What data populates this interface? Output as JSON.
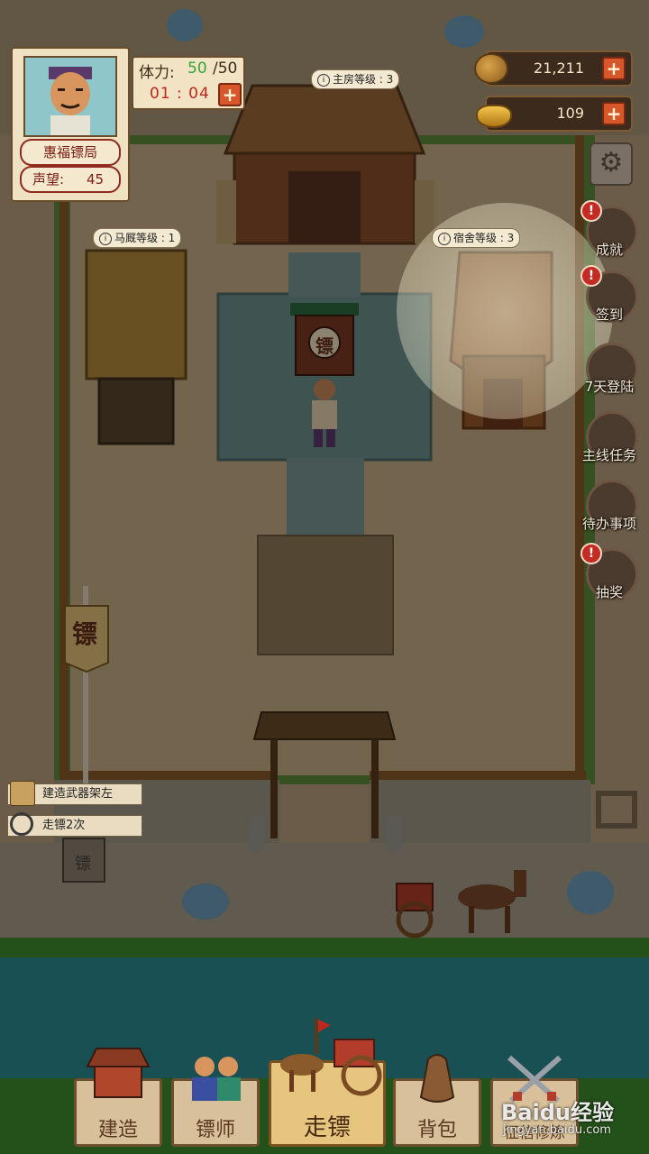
{
  "player": {
    "title": "惠福镖局",
    "reputation_label": "声望:",
    "reputation_value": "45"
  },
  "stamina": {
    "label": "体力:",
    "current": "50",
    "max": "/50",
    "timer": "01 : 04"
  },
  "resources": {
    "coins": "21,211",
    "ingots": "109"
  },
  "buildings": {
    "main_house": "主房等级 : 3",
    "stable": "马厩等级 : 1",
    "dormitory": "宿舍等级 : 3",
    "sign_text": "镖",
    "flag_text": "镖"
  },
  "side_menu": [
    {
      "label": "成就",
      "alert": true,
      "icon": "achievement-icon"
    },
    {
      "label": "签到",
      "alert": true,
      "icon": "checkin-icon"
    },
    {
      "label": "7天登陆",
      "alert": false,
      "icon": "seven-day-login-icon"
    },
    {
      "label": "主线任务",
      "alert": false,
      "icon": "main-quest-icon"
    },
    {
      "label": "待办事项",
      "alert": false,
      "icon": "todo-icon"
    },
    {
      "label": "抽奖",
      "alert": true,
      "icon": "lottery-icon"
    }
  ],
  "tasks": [
    {
      "label": "建造武器架左"
    },
    {
      "label": "走镖2次"
    }
  ],
  "toolbar": {
    "build": "建造",
    "escort_master": "镖师",
    "escort": "走镖",
    "bag": "背包",
    "martial": "征信修炼"
  },
  "watermark": {
    "brand": "Baidu经验",
    "url": "jingyan.baidu.com"
  },
  "colors": {
    "stamina_current": "#37a43a",
    "timer": "#c0271d",
    "alert": "#c32b23",
    "plus_button": "#d7562a"
  }
}
